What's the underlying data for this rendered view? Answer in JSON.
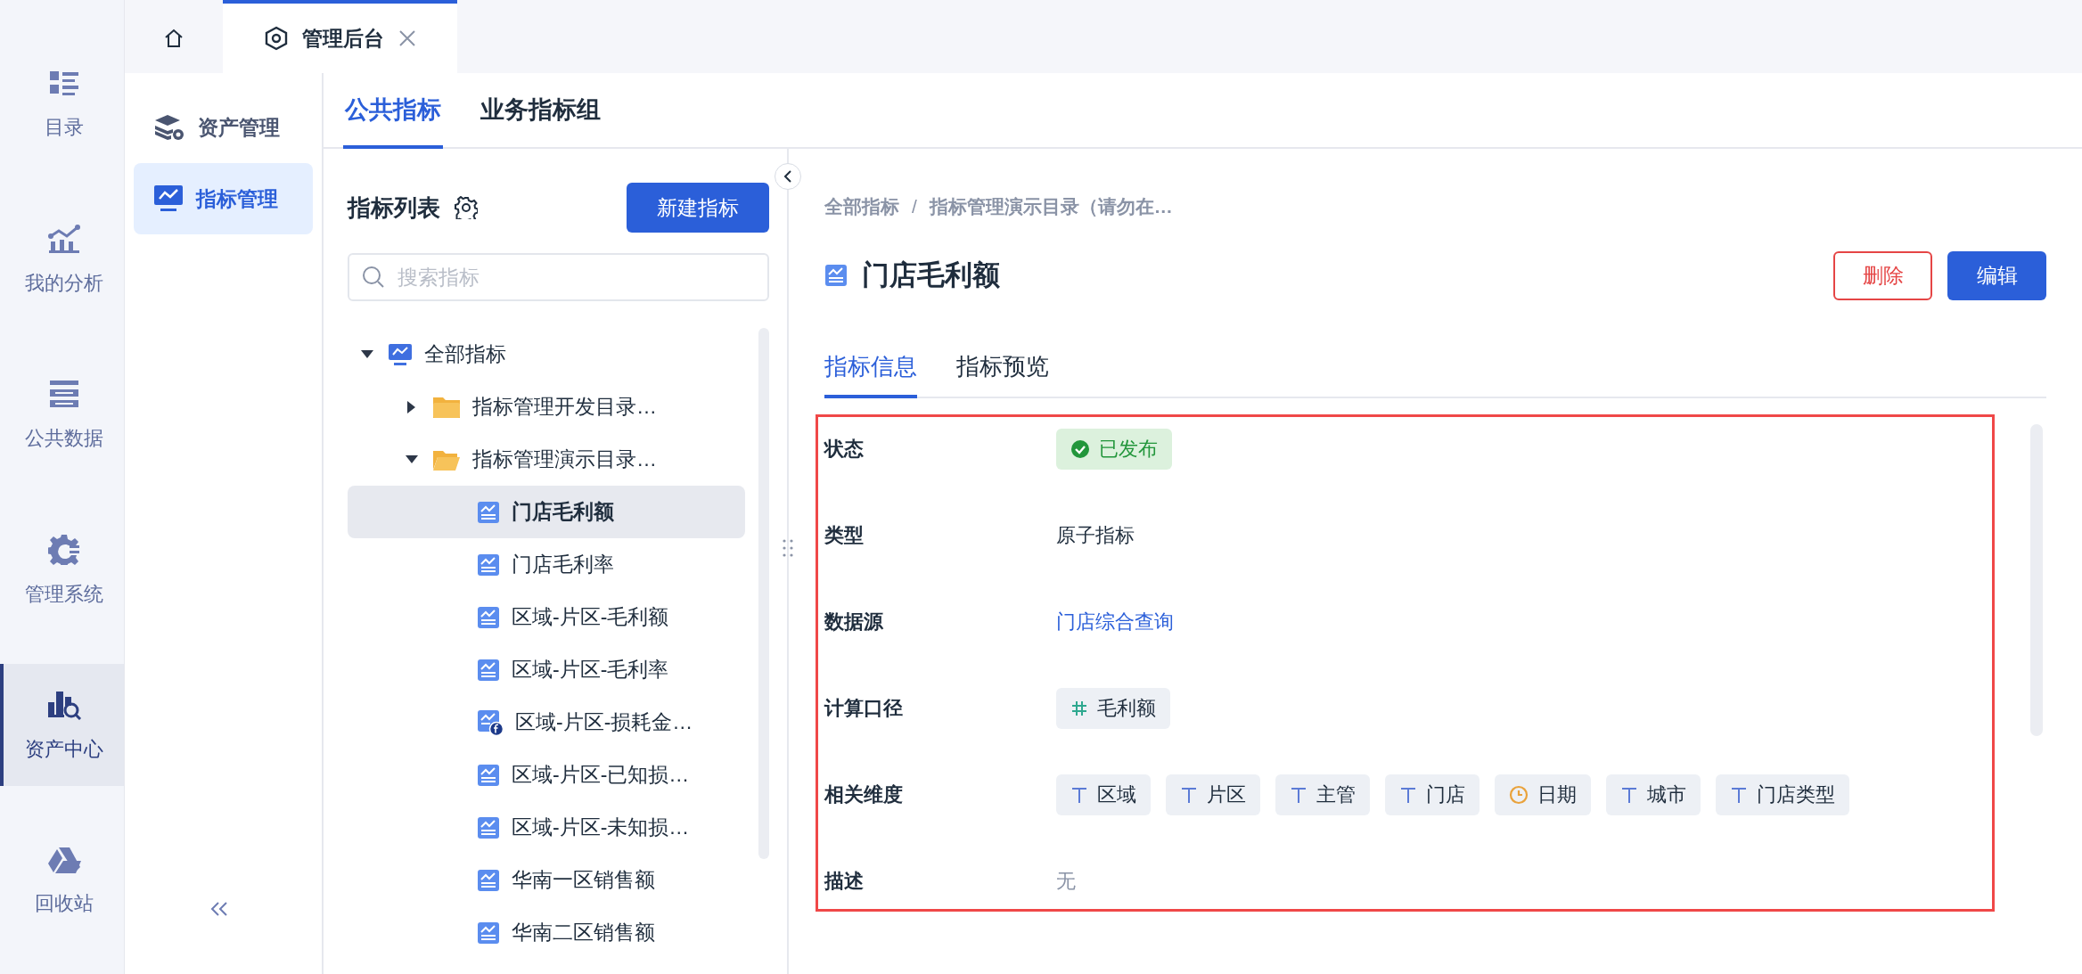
{
  "rail": [
    {
      "label": "目录",
      "selected": false
    },
    {
      "label": "我的分析",
      "selected": false
    },
    {
      "label": "公共数据",
      "selected": false
    },
    {
      "label": "管理系统",
      "selected": false
    },
    {
      "label": "资产中心",
      "selected": true
    },
    {
      "label": "回收站",
      "selected": false
    }
  ],
  "window_tabs": [
    {
      "kind": "home",
      "selected": false
    },
    {
      "kind": "page",
      "label": "管理后台",
      "selected": true
    }
  ],
  "sub_nav": [
    {
      "label": "资产管理",
      "selected": false
    },
    {
      "label": "指标管理",
      "selected": true
    }
  ],
  "section_tabs": [
    {
      "label": "公共指标",
      "selected": true
    },
    {
      "label": "业务指标组",
      "selected": false
    }
  ],
  "list_panel": {
    "title": "指标列表",
    "new_button": "新建指标",
    "search": {
      "placeholder": "搜索指标"
    },
    "tree": [
      {
        "kind": "root",
        "label": "全部指标",
        "expanded": true,
        "selected": false,
        "children": [
          {
            "kind": "folder",
            "label": "指标管理开发目录…",
            "expanded": false,
            "selected": false
          },
          {
            "kind": "folder",
            "label": "指标管理演示目录…",
            "expanded": true,
            "selected": false,
            "children": [
              {
                "kind": "metric",
                "label": "门店毛利额",
                "selected": true
              },
              {
                "kind": "metric",
                "label": "门店毛利率",
                "selected": false
              },
              {
                "kind": "metric",
                "label": "区域-片区-毛利额",
                "selected": false
              },
              {
                "kind": "metric",
                "label": "区域-片区-毛利率",
                "selected": false
              },
              {
                "kind": "formula",
                "label": "区域-片区-损耗金…",
                "selected": false
              },
              {
                "kind": "metric",
                "label": "区域-片区-已知损…",
                "selected": false
              },
              {
                "kind": "metric",
                "label": "区域-片区-未知损…",
                "selected": false
              },
              {
                "kind": "metric",
                "label": "华南一区销售额",
                "selected": false
              },
              {
                "kind": "metric",
                "label": "华南二区销售额",
                "selected": false
              }
            ]
          }
        ]
      }
    ]
  },
  "detail": {
    "breadcrumb": {
      "items": [
        "全部指标",
        "指标管理演示目录（请勿在…"
      ],
      "separator": "/"
    },
    "title": "门店毛利额",
    "buttons": [
      {
        "kind": "danger",
        "label": "删除"
      },
      {
        "kind": "primary",
        "label": "编辑"
      }
    ],
    "tabs": [
      {
        "label": "指标信息",
        "selected": true
      },
      {
        "label": "指标预览",
        "selected": false
      }
    ],
    "fields": [
      {
        "kind": "status",
        "label": "状态",
        "value": "已发布"
      },
      {
        "kind": "text",
        "label": "类型",
        "value": "原子指标"
      },
      {
        "kind": "link",
        "label": "数据源",
        "value": "门店综合查询"
      },
      {
        "kind": "measure",
        "label": "计算口径",
        "value": "毛利额"
      },
      {
        "kind": "tags",
        "label": "相关维度",
        "tags": [
          {
            "kind": "text",
            "label": "区域"
          },
          {
            "kind": "text",
            "label": "片区"
          },
          {
            "kind": "text",
            "label": "主管"
          },
          {
            "kind": "text",
            "label": "门店"
          },
          {
            "kind": "date",
            "label": "日期"
          },
          {
            "kind": "text",
            "label": "城市"
          },
          {
            "kind": "text",
            "label": "门店类型"
          }
        ]
      },
      {
        "kind": "muted",
        "label": "描述",
        "value": "无"
      }
    ]
  }
}
